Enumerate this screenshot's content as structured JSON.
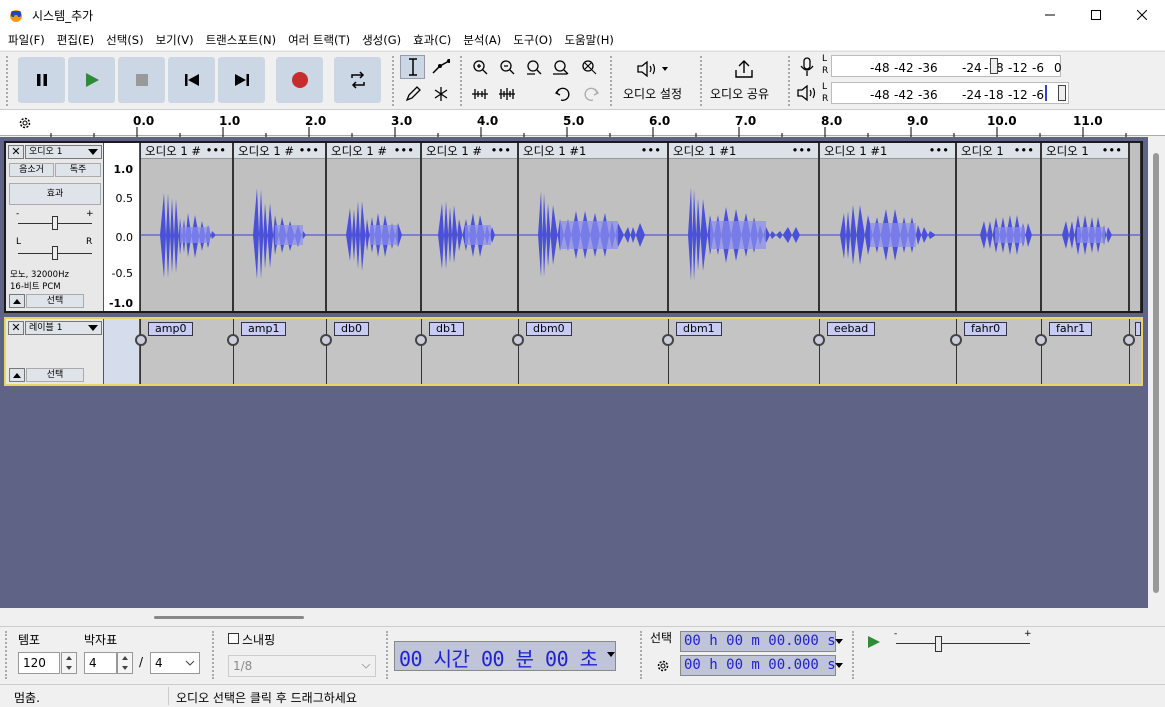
{
  "window": {
    "title": "시스템_추가"
  },
  "menu": [
    "파일(F)",
    "편집(E)",
    "선택(S)",
    "보기(V)",
    "트랜스포트(N)",
    "여러 트랙(T)",
    "생성(G)",
    "효과(C)",
    "분석(A)",
    "도구(O)",
    "도움말(H)"
  ],
  "toolbar": {
    "audio_setup": "오디오 설정",
    "share_audio": "오디오 공유",
    "meter_ticks_rec": [
      "-48",
      "-42",
      "-36",
      "-24",
      "-18",
      "-12",
      "-6",
      "0"
    ],
    "meter_ticks_play": [
      "-48",
      "-42",
      "-36",
      "-24",
      "-18",
      "-12",
      "-6"
    ],
    "meter_L": "L",
    "meter_R": "R"
  },
  "ruler": {
    "ticks": [
      "0.0",
      "1.0",
      "2.0",
      "3.0",
      "4.0",
      "5.0",
      "6.0",
      "7.0",
      "8.0",
      "9.0",
      "10.0",
      "11.0"
    ]
  },
  "audio_track": {
    "name": "오디오 1",
    "mute": "음소거",
    "solo": "독주",
    "effects": "효과",
    "info_line1": "모노, 32000Hz",
    "info_line2": "16-비트 PCM",
    "select": "선택",
    "pan_L": "L",
    "pan_R": "R",
    "gain_minus": "-",
    "gain_plus": "+",
    "scale": [
      "1.0",
      "0.5",
      "0.0",
      "-0.5",
      "-1.0"
    ],
    "clips": [
      "오디오 1 #",
      "오디오 1 #",
      "오디오 1 #",
      "오디오 1 #",
      "오디오 1 #1",
      "오디오 1 #1",
      "오디오 1 #1",
      "오디오 1",
      "오디오 1"
    ],
    "clip_menu": "•••"
  },
  "label_track": {
    "name": "레이블 1",
    "select": "선택",
    "labels": [
      "amp0",
      "amp1",
      "db0",
      "db1",
      "dbm0",
      "dbm1",
      "eebad",
      "fahr0",
      "fahr1"
    ]
  },
  "bottom": {
    "tempo_label": "템포",
    "tempo_value": "120",
    "timesig_label": "박자표",
    "timesig_num": "4",
    "timesig_sep": "/",
    "timesig_den": "4",
    "snap_label": "스내핑",
    "snap_value": "1/8",
    "time_display": "00 시간 00 분 00 초",
    "selection_label": "선택",
    "sel_start": "00 h 00 m 00.000 s",
    "sel_end": "00 h 00 m 00.000 s",
    "play_minus": "-",
    "play_plus": "+"
  },
  "status": {
    "left": "멈춤.",
    "right": "오디오 선택은 클릭 후 드래그하세요"
  }
}
